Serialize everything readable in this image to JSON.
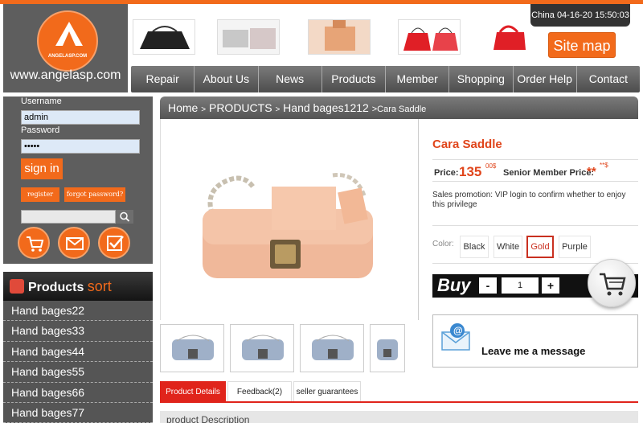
{
  "logo": {
    "small_text": "ANGELASP.COM",
    "url_text": "www.angelasp.com"
  },
  "header": {
    "datetime": "China 04-16-20 15:50:03",
    "sitemap_label": "Site map"
  },
  "nav": {
    "items": [
      "Repair",
      "About Us",
      "News",
      "Products",
      "Member",
      "Shopping",
      "Order Help",
      "Contact"
    ]
  },
  "login": {
    "username_label": "Username",
    "username_value": "admin",
    "password_label": "Password",
    "password_value": "•••••",
    "signin_label": "sign in",
    "register_label": "register",
    "forgot_label": "forgot password?"
  },
  "sidebar": {
    "title": "Products",
    "title_accent": "sort",
    "items": [
      "Hand bages22",
      "Hand bages33",
      "Hand bages44",
      "Hand bages55",
      "Hand bages66",
      "Hand bages77"
    ]
  },
  "breadcrumb": {
    "home": "Home",
    "sep": ">",
    "products": "PRODUCTS",
    "category": "Hand bages1212",
    "current": ">Cara Saddle"
  },
  "product": {
    "name": "Cara Saddle",
    "price_label": "Price:",
    "price_value": "135",
    "price_currency": "00$",
    "senior_label": "Senior Member Price:",
    "senior_value": "**",
    "senior_currency": "**$",
    "promo": "Sales promotion: VIP login to confirm whether to enjoy this privilege",
    "color_label": "Color:",
    "colors": [
      "Black",
      "White",
      "Gold",
      "Purple"
    ],
    "selected_color": "Gold",
    "buy_label": "Buy",
    "qty_minus": "-",
    "qty_value": "1",
    "qty_plus": "+"
  },
  "message": {
    "label": "Leave me a message"
  },
  "tabs": {
    "items": [
      "Product Details",
      "Feedback(2)",
      "seller guarantees"
    ],
    "active": "Product Details"
  },
  "description": {
    "header": "product Description"
  },
  "colors": {
    "accent": "#f26a1b",
    "price_red": "#e0451b",
    "tab_red": "#e0241b",
    "dark_gray": "#5e5e5e"
  }
}
